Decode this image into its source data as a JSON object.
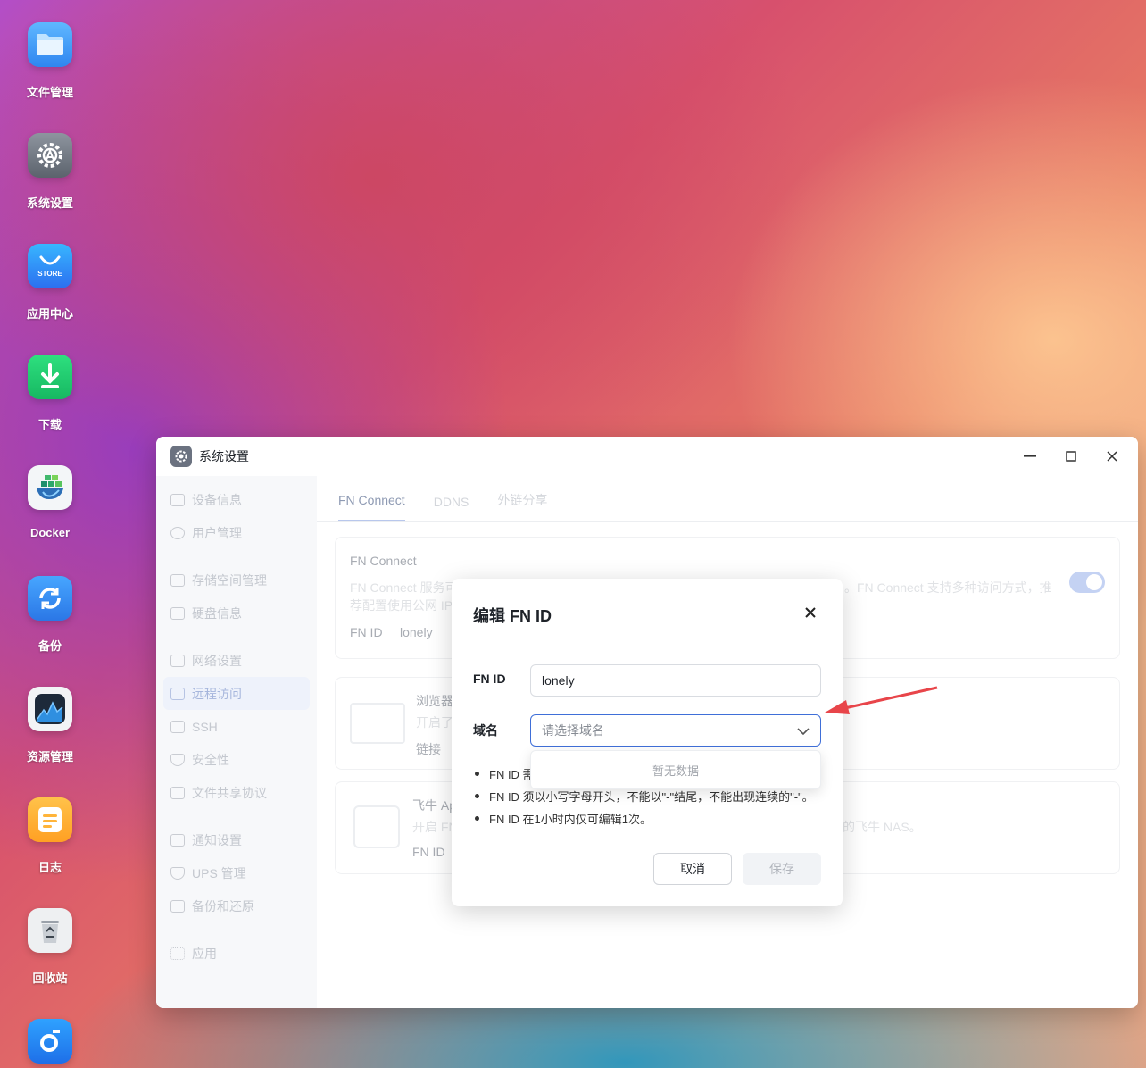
{
  "desktop": {
    "icons": [
      {
        "name": "files",
        "label": "文件管理"
      },
      {
        "name": "settings",
        "label": "系统设置"
      },
      {
        "name": "app-center",
        "label": "应用中心",
        "badge": "STORE"
      },
      {
        "name": "download",
        "label": "下载"
      },
      {
        "name": "docker",
        "label": "Docker"
      },
      {
        "name": "backup",
        "label": "备份"
      },
      {
        "name": "resource-monitor",
        "label": "资源管理"
      },
      {
        "name": "log",
        "label": "日志"
      },
      {
        "name": "recycle-bin",
        "label": "回收站"
      }
    ]
  },
  "window": {
    "title": "系统设置",
    "sidebar": {
      "items": [
        {
          "label": "设备信息",
          "icon": "device-icon"
        },
        {
          "label": "用户管理",
          "icon": "user-icon"
        },
        {
          "label": "存储空间管理",
          "icon": "storage-icon"
        },
        {
          "label": "硬盘信息",
          "icon": "disk-icon"
        },
        {
          "label": "网络设置",
          "icon": "network-icon"
        },
        {
          "label": "远程访问",
          "icon": "send-icon",
          "active": true
        },
        {
          "label": "SSH",
          "icon": "terminal-icon"
        },
        {
          "label": "安全性",
          "icon": "shield-icon"
        },
        {
          "label": "文件共享协议",
          "icon": "file-icon"
        },
        {
          "label": "通知设置",
          "icon": "mail-icon"
        },
        {
          "label": "UPS 管理",
          "icon": "shield-icon"
        },
        {
          "label": "备份和还原",
          "icon": "download-icon"
        },
        {
          "label": "应用",
          "icon": "apps-icon"
        }
      ]
    },
    "tabs": [
      {
        "label": "FN Connect",
        "active": true
      },
      {
        "label": "DDNS"
      },
      {
        "label": "外链分享"
      }
    ],
    "card1": {
      "title": "FN Connect",
      "desc_line1": "FN Connect 服务可",
      "desc_right": "。FN Connect 支持多种访问方式，推",
      "desc_line2": "荐配置使用公网 IP",
      "fnid_label": "FN ID",
      "fnid_value": "lonely"
    },
    "card2": {
      "title": "浏览器",
      "desc": "开启了",
      "link": "链接"
    },
    "card3": {
      "title": "飞牛 Ap",
      "desc": "开启 FN",
      "desc_right": "的飞牛 NAS。",
      "fnid_label": "FN ID"
    }
  },
  "modal": {
    "title": "编辑 FN ID",
    "fnid_label": "FN ID",
    "fnid_value": "lonely",
    "domain_label": "域名",
    "domain_placeholder": "请选择域名",
    "dropdown_empty": "暂无数据",
    "notes": [
      "FN ID 需",
      "FN ID 须以小写字母开头，不能以\"-\"结尾，不能出现连续的\"-\"。",
      "FN ID 在1小时内仅可编辑1次。"
    ],
    "cancel_label": "取消",
    "save_label": "保存"
  },
  "colors": {
    "accent": "#3f6fd8",
    "annotation_arrow": "#e8454a"
  }
}
